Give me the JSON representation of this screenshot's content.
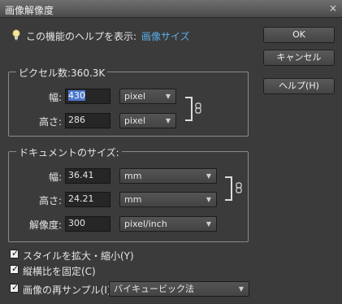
{
  "window": {
    "title": "画像解像度",
    "close_glyph": "×"
  },
  "help": {
    "prefix": "この機能のヘルプを表示:",
    "link": "画像サイズ"
  },
  "buttons": {
    "ok": "OK",
    "cancel": "キャンセル",
    "help": "ヘルプ(H)"
  },
  "pixel_dimensions": {
    "title": "ピクセル数:360.3K",
    "width": {
      "label": "幅:",
      "value": "430",
      "unit": "pixel"
    },
    "height": {
      "label": "高さ:",
      "value": "286",
      "unit": "pixel"
    }
  },
  "document_size": {
    "title": "ドキュメントのサイズ:",
    "width": {
      "label": "幅:",
      "value": "36.41",
      "unit": "mm"
    },
    "height": {
      "label": "高さ:",
      "value": "24.21",
      "unit": "mm"
    },
    "resolution": {
      "label": "解像度:",
      "value": "300",
      "unit": "pixel/inch"
    }
  },
  "options": {
    "scale_styles": {
      "label": "スタイルを拡大・縮小(Y)",
      "checked": true
    },
    "constrain": {
      "label": "縦横比を固定(C)",
      "checked": true
    },
    "resample": {
      "label": "画像の再サンプル(I):",
      "checked": true,
      "method": "バイキュービック法"
    }
  },
  "icons": {
    "bulb": "lightbulb-icon",
    "chain": "link-icon",
    "dropdown": "▼",
    "check": "✓"
  },
  "colors": {
    "background": "#3b3b3b",
    "link": "#5aaeea",
    "selection": "#4d78cc"
  }
}
